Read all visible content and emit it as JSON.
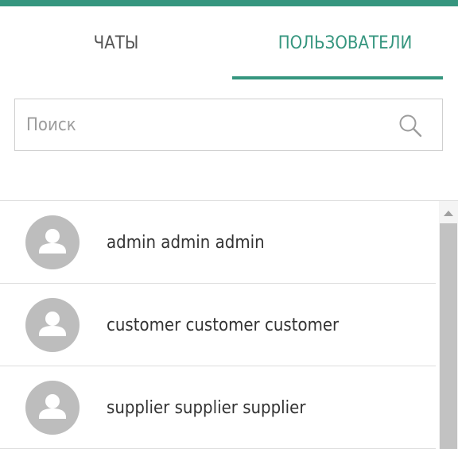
{
  "tabs": [
    {
      "label": "ЧАТЫ",
      "active": false
    },
    {
      "label": "ПОЛЬЗОВАТЕЛИ",
      "active": true
    }
  ],
  "search": {
    "placeholder": "Поиск",
    "value": "",
    "icon": "search-icon"
  },
  "users": [
    {
      "name": "admin admin admin",
      "avatar": "user-avatar-icon"
    },
    {
      "name": "customer customer customer",
      "avatar": "user-avatar-icon"
    },
    {
      "name": "supplier supplier supplier",
      "avatar": "user-avatar-icon"
    }
  ],
  "colors": {
    "accent": "#36967f",
    "tab_inactive": "#555555",
    "avatar_bg": "#bdbdbd",
    "border": "#dddddd"
  }
}
